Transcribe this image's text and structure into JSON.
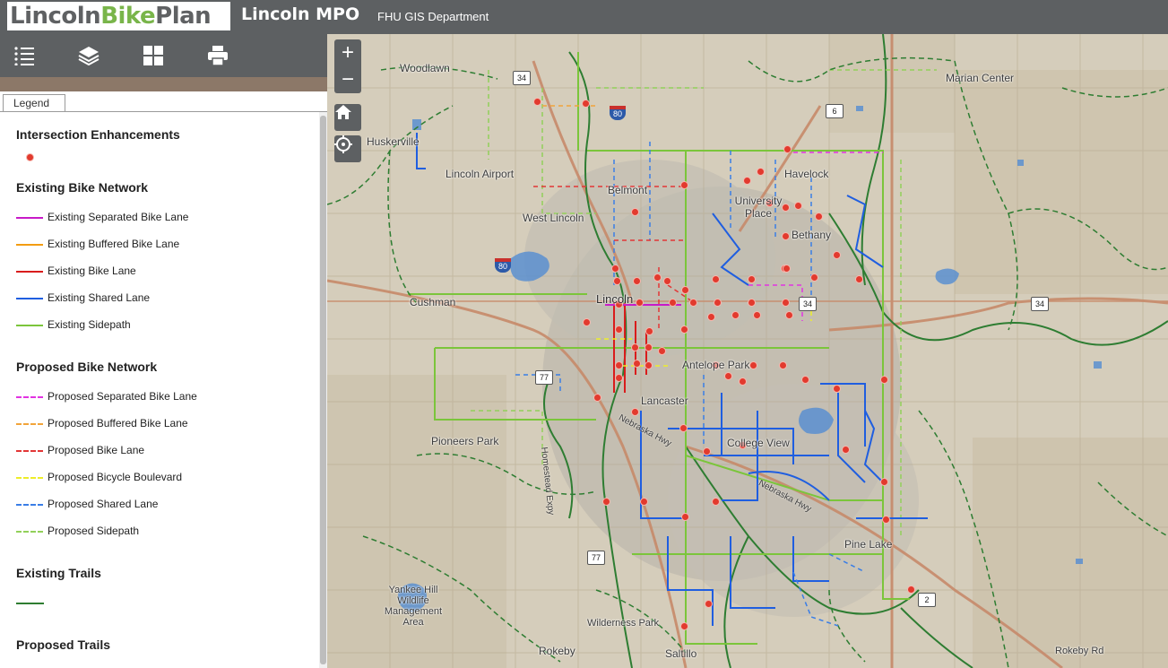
{
  "header": {
    "logo_part1": "Lincoln",
    "logo_part2": "Bike",
    "logo_part3": "Plan",
    "title": "Lincoln MPO",
    "subtitle": "FHU GIS Department"
  },
  "toolbar": {
    "legend_icon": "list-icon",
    "layers_icon": "layers-icon",
    "basemap_icon": "grid-icon",
    "print_icon": "printer-icon"
  },
  "tabs": {
    "legend": "Legend"
  },
  "legend": {
    "intersection_heading": "Intersection Enhancements",
    "existing_heading": "Existing Bike Network",
    "existing": [
      {
        "label": "Existing Separated Bike Lane",
        "color": "#c81ac8"
      },
      {
        "label": "Existing Buffered Bike Lane",
        "color": "#f39c12"
      },
      {
        "label": "Existing Bike Lane",
        "color": "#d91c1c"
      },
      {
        "label": "Existing Shared Lane",
        "color": "#1f5ee0"
      },
      {
        "label": "Existing Sidepath",
        "color": "#7bc53b"
      }
    ],
    "proposed_heading": "Proposed Bike Network",
    "proposed": [
      {
        "label": "Proposed Separated Bike Lane",
        "color": "#e233e2"
      },
      {
        "label": "Proposed Buffered Bike Lane",
        "color": "#f2a43a"
      },
      {
        "label": "Proposed Bike Lane",
        "color": "#e23636"
      },
      {
        "label": "Proposed Bicycle Boulevard",
        "color": "#eded2a"
      },
      {
        "label": "Proposed Shared Lane",
        "color": "#3a7ee6"
      },
      {
        "label": "Proposed Sidepath",
        "color": "#92d05a"
      }
    ],
    "trails_existing_heading": "Existing Trails",
    "trail_existing_color": "#2e7d32",
    "trails_proposed_heading": "Proposed Trails"
  },
  "map": {
    "zoom_in": "+",
    "zoom_out": "−",
    "places": {
      "woodlawn": "Woodlawn",
      "huskerville": "Huskerville",
      "lincoln_airport": "Lincoln Airport",
      "belmont": "Belmont",
      "west_lincoln": "West Lincoln",
      "university_place": "University Place",
      "havelock": "Havelock",
      "bethany": "Bethany",
      "marian_center": "Marian Center",
      "cushman": "Cushman",
      "lincoln": "Lincoln",
      "antelope_park": "Antelope Park",
      "lancaster": "Lancaster",
      "college_view": "College View",
      "pioneers_park": "Pioneers Park",
      "pine_lake": "Pine Lake",
      "yankee_hill": "Yankee Hill Wildlife Management Area",
      "wilderness_park": "Wilderness Park",
      "rokeby": "Rokeby",
      "saltillo": "Saltillo",
      "rokeby_rd": "Rokeby Rd"
    },
    "roads": {
      "nebraska_hwy_1": "Nebraska Hwy",
      "nebraska_hwy_2": "Nebraska Hwy",
      "homestead_expy": "Homestead Expy"
    },
    "shields": {
      "us34_a": "34",
      "us6": "6",
      "i80_a": "80",
      "i80_b": "80",
      "us34_b": "34",
      "us34_c": "34",
      "us77_a": "77",
      "us77_b": "77",
      "ne2": "2"
    }
  }
}
